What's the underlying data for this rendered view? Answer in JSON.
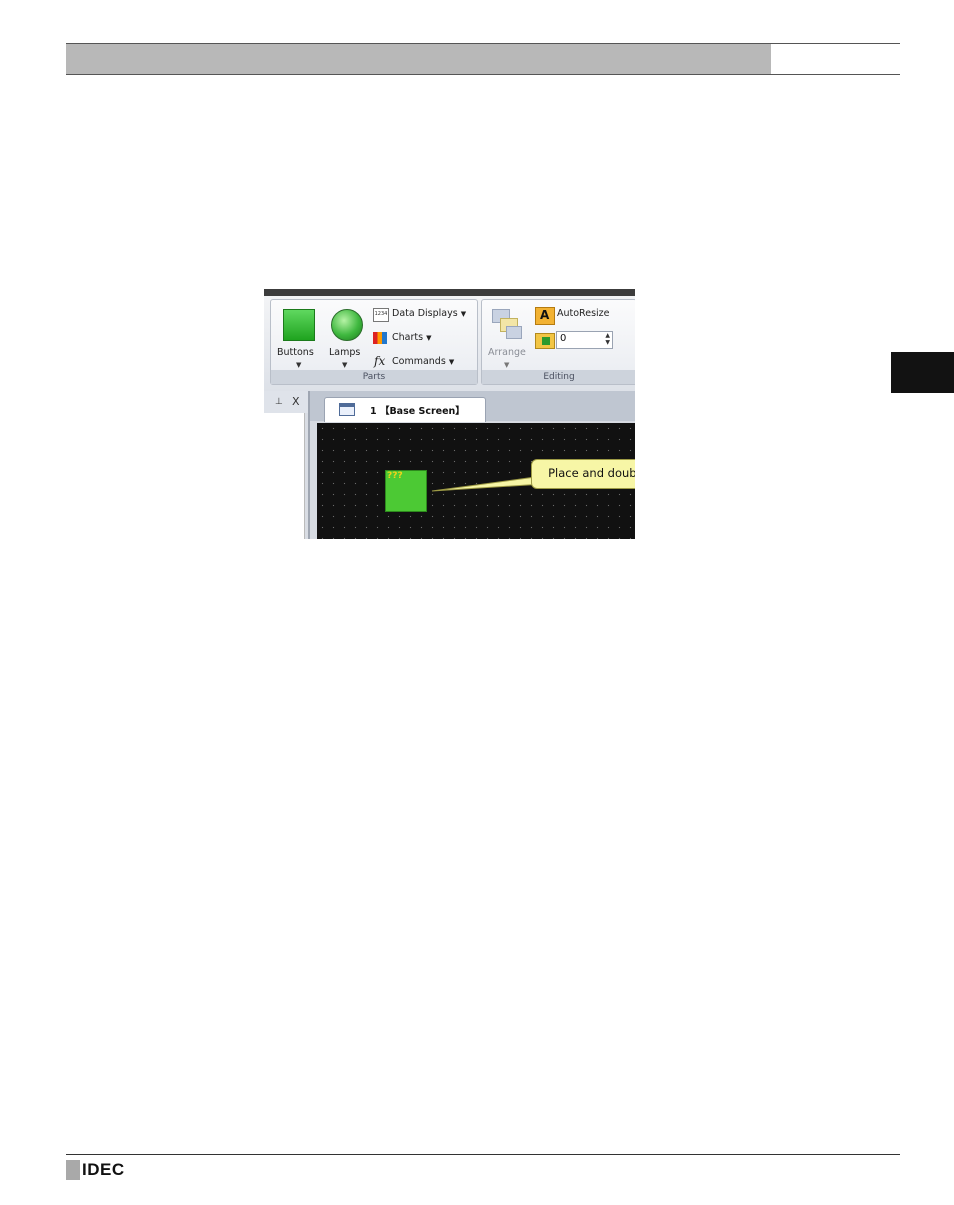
{
  "footer": {
    "logo_text": "IDEC"
  },
  "screenshot": {
    "parts_group": {
      "label": "Parts",
      "buttons_label": "Buttons",
      "lamps_label": "Lamps",
      "data_displays_label": "Data Displays",
      "data_displays_icon_text": "1234",
      "charts_label": "Charts",
      "commands_label": "Commands"
    },
    "editing_group": {
      "label": "Editing",
      "arrange_label": "Arrange",
      "autoresize_label": "AutoResize",
      "spin_value": "0"
    },
    "tab": {
      "number": "1",
      "title": "【Base Screen】"
    },
    "part_placeholder": "???",
    "callout_text": "Place and double click."
  }
}
